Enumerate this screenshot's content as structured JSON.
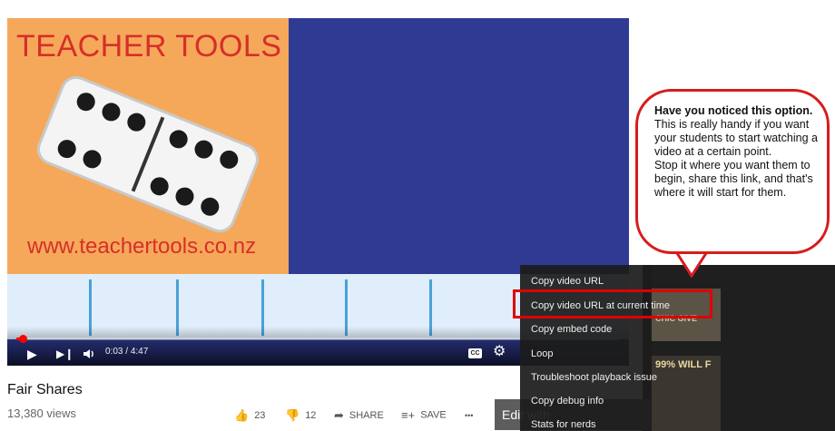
{
  "video": {
    "thumbnail_title": "TEACHER TOOLS",
    "thumbnail_url": "www.teachertools.co.nz",
    "time_current": "0:03",
    "time_total": "4:47",
    "progress": 0.0105,
    "icons": {
      "play": "play-icon",
      "next": "next-icon",
      "volume": "volume-icon",
      "cc": "captions-icon",
      "settings": "settings-gear-icon"
    },
    "accent_color": "#ff0000"
  },
  "video_info": {
    "title": "Fair Shares",
    "views": "13,380 views",
    "likes": "23",
    "dislikes": "12",
    "share_label": "SHARE",
    "save_label": "SAVE",
    "more_label": "•••",
    "edit_label": "Edit with"
  },
  "context_menu": {
    "items": [
      "Copy video URL",
      "Copy video URL at current time",
      "Copy embed code",
      "Loop",
      "Troubleshoot playback issue",
      "Copy debug info",
      "Stats for nerds"
    ],
    "highlighted_index": 1
  },
  "callout": {
    "heading": "Have you noticed this option.",
    "body": "This is really handy if you want your students to start watching a video at a certain point.",
    "body2": "Stop it where you want them to begin, share this link, and that's where it will start for them.",
    "border_color": "#d81b1b"
  },
  "sidebar_ad": {
    "text1": "CHIC GIVE",
    "text2": "99% WILL F"
  }
}
